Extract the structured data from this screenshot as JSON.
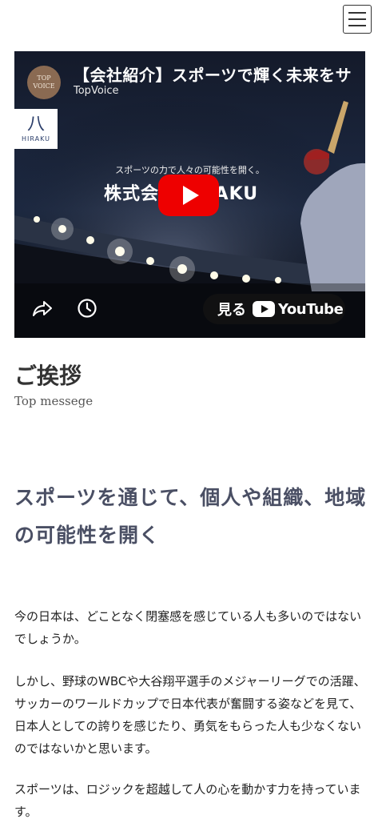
{
  "video": {
    "title": "【会社紹介】スポーツで輝く未来をサ",
    "channel": "TopVoice",
    "channel_avatar": "TOP VOICE",
    "logo_mark": "八",
    "logo_text": "HIRAKU",
    "tagline": "スポーツの力で人々の可能性を開く。",
    "company": "株式会社HIRAKU",
    "watch_label": "見る",
    "youtube": "YouTube"
  },
  "section": {
    "title": "ご挨拶",
    "subtitle": "Top messege"
  },
  "headline": "スポーツを通じて、個人や組織、地域の可能性を開く",
  "paragraphs": [
    "今の日本は、どことなく閉塞感を感じている人も多いのではないでしょうか。",
    "しかし、野球のWBCや大谷翔平選手のメジャーリーグでの活躍、サッカーのワールドカップで日本代表が奮闘する姿などを見て、日本人としての誇りを感じたり、勇気をもらった人も少なくないのではないかと思います。",
    "スポーツは、ロジックを超越して人の心を動かす力を持っています。"
  ],
  "icons": [
    "menu-icon",
    "play-icon",
    "share-icon",
    "clock-icon",
    "youtube-icon"
  ],
  "colors": {
    "headline": "#4a4f64",
    "play_button": "#ee0000"
  }
}
